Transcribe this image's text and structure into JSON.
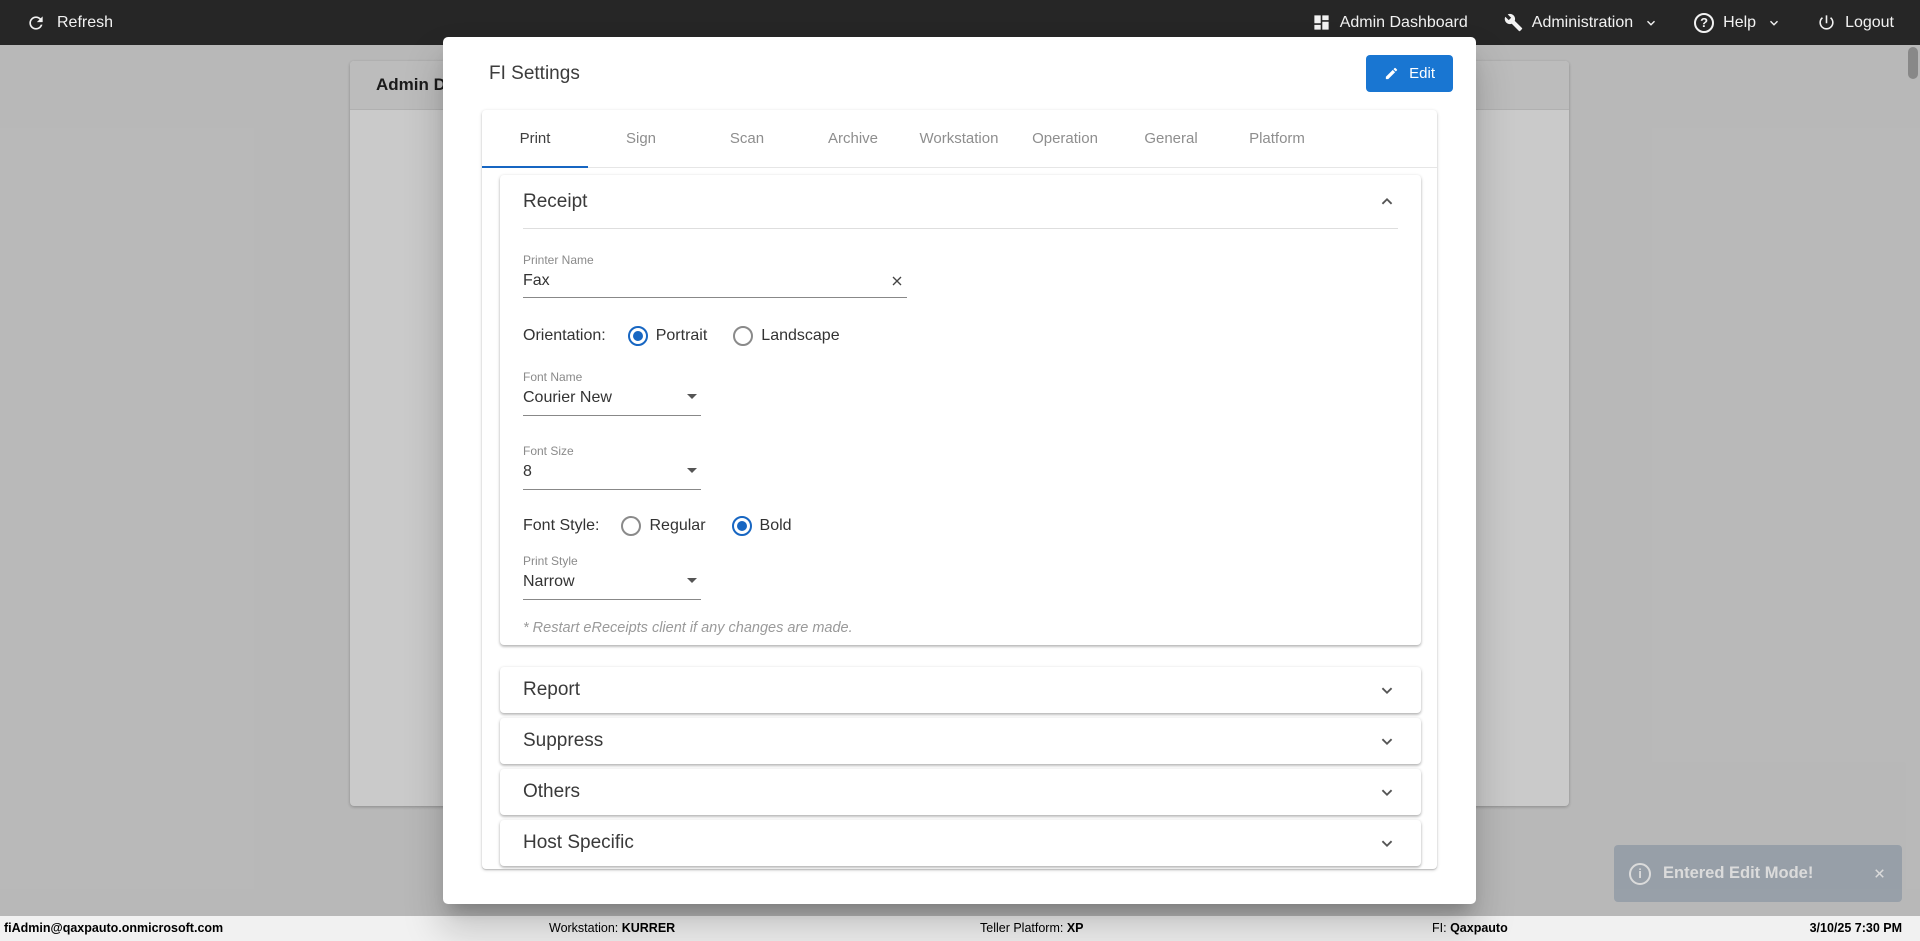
{
  "topbar": {
    "refresh": "Refresh",
    "admin_dashboard": "Admin Dashboard",
    "administration": "Administration",
    "help": "Help",
    "help_glyph": "?",
    "logout": "Logout"
  },
  "background_page": {
    "card_title": "Admin D"
  },
  "modal": {
    "title": "FI Settings",
    "edit_button": "Edit",
    "tabs": [
      {
        "label": "Print",
        "active": true
      },
      {
        "label": "Sign",
        "active": false
      },
      {
        "label": "Scan",
        "active": false
      },
      {
        "label": "Archive",
        "active": false
      },
      {
        "label": "Workstation",
        "active": false
      },
      {
        "label": "Operation",
        "active": false
      },
      {
        "label": "General",
        "active": false
      },
      {
        "label": "Platform",
        "active": false
      }
    ],
    "receipt": {
      "title": "Receipt",
      "printer_name": {
        "label": "Printer Name",
        "value": "Fax"
      },
      "orientation": {
        "label": "Orientation:",
        "options": [
          "Portrait",
          "Landscape"
        ],
        "selected": "Portrait"
      },
      "font_name": {
        "label": "Font Name",
        "value": "Courier New"
      },
      "font_size": {
        "label": "Font Size",
        "value": "8"
      },
      "font_style": {
        "label": "Font Style:",
        "options": [
          "Regular",
          "Bold"
        ],
        "selected": "Bold"
      },
      "print_style": {
        "label": "Print Style",
        "value": "Narrow"
      },
      "note": "* Restart eReceipts client if any changes are made."
    },
    "collapsed_sections": [
      "Report",
      "Suppress",
      "Others",
      "Host Specific"
    ]
  },
  "toast": {
    "message": "Entered Edit Mode!",
    "info_glyph": "i"
  },
  "statusbar": {
    "user": "fiAdmin@qaxpauto.onmicrosoft.com",
    "workstation_label": "Workstation: ",
    "workstation_value": "KURRER",
    "teller_platform_label": "Teller Platform: ",
    "teller_platform_value": "XP",
    "fi_label": "FI: ",
    "fi_value": "Qaxpauto",
    "datetime": "3/10/25 7:30 PM"
  },
  "colors": {
    "accent_blue": "#1976d2",
    "tab_indicator": "#1766c2",
    "topbar_bg": "#262626"
  }
}
